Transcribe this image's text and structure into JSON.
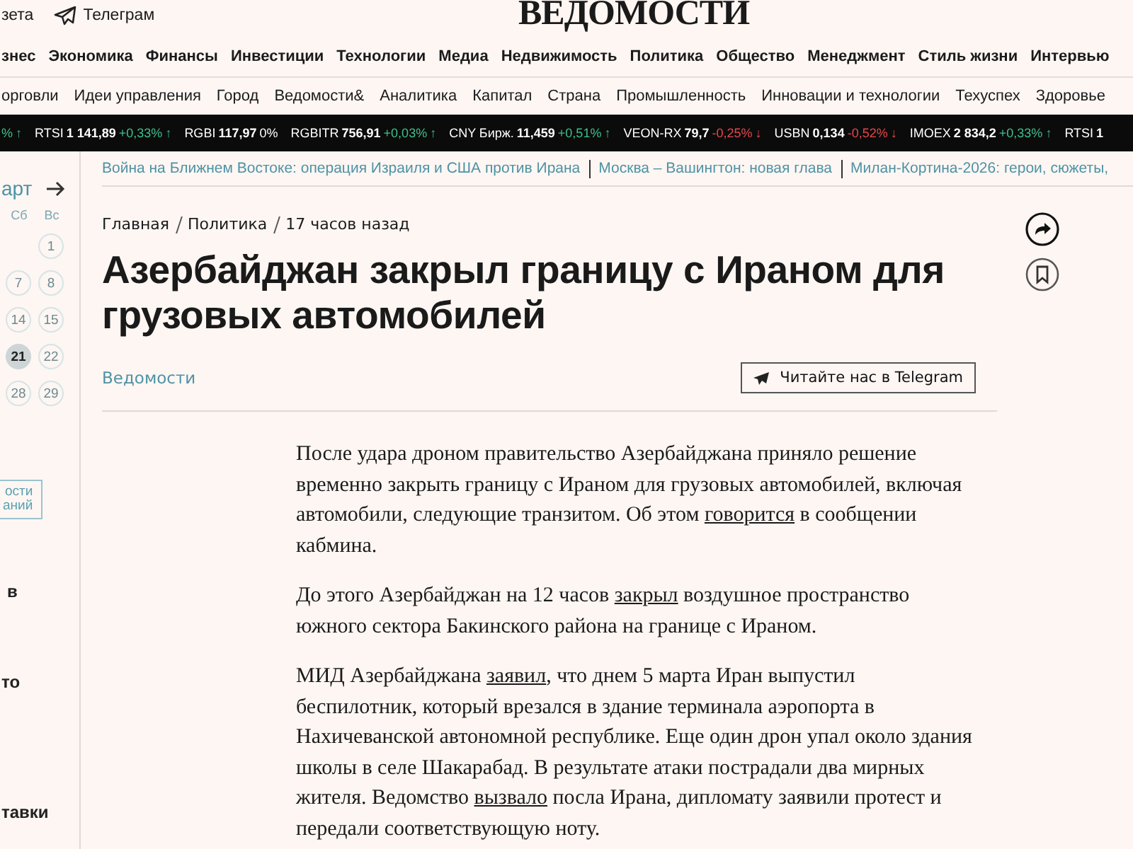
{
  "top_bar": {
    "links": [
      {
        "label": "зета",
        "kind": "text"
      },
      {
        "label": "Телеграм",
        "kind": "telegram"
      }
    ],
    "logo": "ВЕДОМОСТИ"
  },
  "nav_primary": [
    "знес",
    "Экономика",
    "Финансы",
    "Инвестиции",
    "Технологии",
    "Медиа",
    "Недвижимость",
    "Политика",
    "Общество",
    "Менеджмент",
    "Стиль жизни",
    "Интервью"
  ],
  "nav_secondary": [
    "орговли",
    "Идеи управления",
    "Город",
    "Ведомости&",
    "Аналитика",
    "Капитал",
    "Страна",
    "Промышленность",
    "Инновации и технологии",
    "Техуспех",
    "Здоровье"
  ],
  "ticker": [
    {
      "change": "%",
      "arrow": "↑",
      "color": "#3fbf8f"
    },
    {
      "name": "RTSI",
      "value": "1 141,89",
      "change": "+0,33%",
      "arrow": "↑",
      "color": "#3fbf8f"
    },
    {
      "name": "RGBI",
      "value": "117,97",
      "change": "0%",
      "color": "#ffffff"
    },
    {
      "name": "RGBITR",
      "value": "756,91",
      "change": "+0,03%",
      "arrow": "↑",
      "color": "#3fbf8f"
    },
    {
      "name": "CNY Бирж.",
      "value": "11,459",
      "change": "+0,51%",
      "arrow": "↑",
      "color": "#3fbf8f"
    },
    {
      "name": "VEON-RX",
      "value": "79,7",
      "change": "-0,25%",
      "arrow": "↓",
      "color": "#e8464a"
    },
    {
      "name": "USBN",
      "value": "0,134",
      "change": "-0,52%",
      "arrow": "↓",
      "color": "#e8464a"
    },
    {
      "name": "IMOEX",
      "value": "2 834,2",
      "change": "+0,33%",
      "arrow": "↑",
      "color": "#3fbf8f"
    },
    {
      "name": "RTSI",
      "value": "1"
    }
  ],
  "topics": [
    "Война на Ближнем Востоке: операция Израиля и США против Ирана",
    "Москва – Вашингтон: новая глава",
    "Милан-Кортина-2026: герои, сюжеты,"
  ],
  "sidebar": {
    "month": "арт",
    "weekdays": [
      "Сб",
      "Вс"
    ],
    "days": [
      {
        "label": "1",
        "selected": false
      },
      {
        "label": "7",
        "selected": false
      },
      {
        "label": "8",
        "selected": false
      },
      {
        "label": "14",
        "selected": false
      },
      {
        "label": "15",
        "selected": false
      },
      {
        "label": "21",
        "selected": true
      },
      {
        "label": "22",
        "selected": false
      },
      {
        "label": "28",
        "selected": false
      },
      {
        "label": "29",
        "selected": false
      }
    ],
    "button_lines": [
      "ости",
      "аний"
    ],
    "fragments": [
      "в",
      "то",
      "тавки"
    ]
  },
  "article": {
    "breadcrumbs": [
      "Главная",
      "Политика",
      "17 часов назад"
    ],
    "title": "Азербайджан закрыл границу с Ираном для грузовых автомобилей",
    "source": "Ведомости",
    "telegram_button": "Читайте нас в Telegram",
    "paragraphs": [
      [
        {
          "kind": "text",
          "text": "После удара дроном правительство Азербайджана приняло решение временно закрыть границу с Ираном для грузовых автомобилей, включая автомобили, следующие транзитом. Об этом "
        },
        {
          "kind": "link",
          "text": "говорится"
        },
        {
          "kind": "text",
          "text": " в сообщении кабмина."
        }
      ],
      [
        {
          "kind": "text",
          "text": "До этого Азербайджан на 12 часов "
        },
        {
          "kind": "link",
          "text": "закрыл"
        },
        {
          "kind": "text",
          "text": " воздушное пространство южного сектора Бакинского района на границе с Ираном."
        }
      ],
      [
        {
          "kind": "text",
          "text": "МИД Азербайджана "
        },
        {
          "kind": "link",
          "text": "заявил"
        },
        {
          "kind": "text",
          "text": ", что днем 5 марта Иран выпустил беспилотник, который врезался в здание терминала аэропорта в Нахичеванской автономной республике. Еще один дрон упал около здания школы в селе Шакарабад. В результате атаки пострадали два мирных жителя. Ведомство "
        },
        {
          "kind": "link",
          "text": "вызвало"
        },
        {
          "kind": "text",
          "text": " посла Ирана, дипломату заявили протест и передали соответствующую ноту."
        }
      ]
    ]
  }
}
